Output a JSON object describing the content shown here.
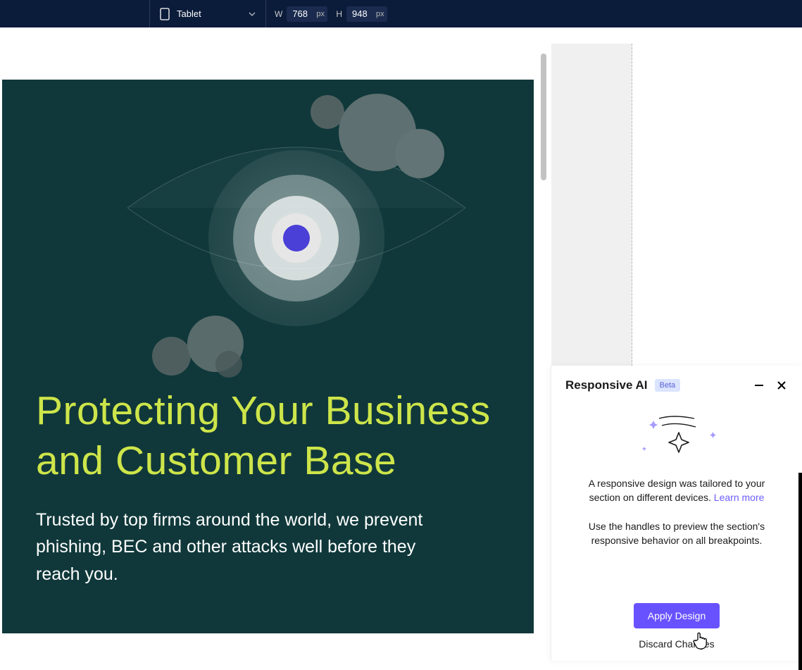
{
  "toolbar": {
    "device_label": "Tablet",
    "width_label": "W",
    "width_value": "768",
    "width_unit": "px",
    "height_label": "H",
    "height_value": "948",
    "height_unit": "px"
  },
  "hero": {
    "title": "Protecting Your Business and Customer Base",
    "subtitle": "Trusted by top firms around the world, we prevent phishing, BEC and other attacks well before they reach you."
  },
  "panel": {
    "title": "Responsive AI",
    "badge": "Beta",
    "message1_pre": "A responsive design was tailored to your section on different devices. ",
    "learn_more": "Learn more",
    "message2": "Use the handles to preview the section's responsive behavior on all breakpoints.",
    "apply_label": "Apply Design",
    "discard_label": "Discard Changes"
  },
  "colors": {
    "accent": "#6852ff",
    "hero_bg": "#10383a",
    "hero_heading": "#cde54a"
  }
}
